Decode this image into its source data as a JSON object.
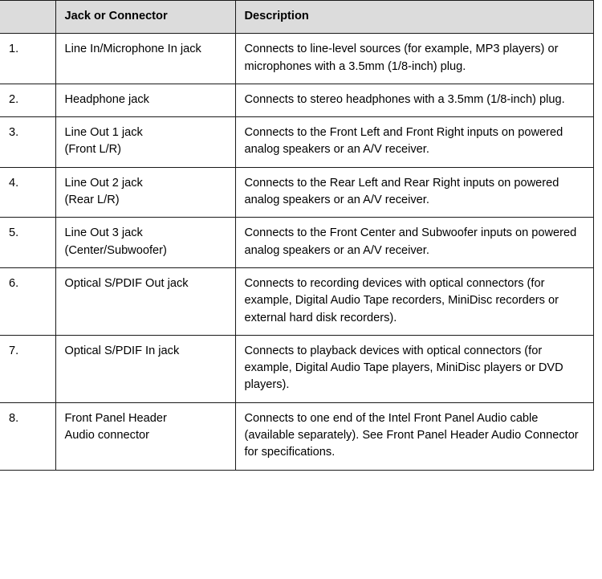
{
  "table": {
    "headers": {
      "number": "",
      "jack": "Jack or Connector",
      "description": "Description"
    },
    "rows": [
      {
        "number": "1.",
        "jack": "Line In/Microphone In jack",
        "description": "Connects to line-level sources (for example, MP3 players) or microphones with a 3.5mm (1/8-inch) plug."
      },
      {
        "number": "2.",
        "jack": "Headphone jack",
        "description": "Connects to stereo headphones with a 3.5mm (1/8-inch) plug."
      },
      {
        "number": "3.",
        "jack": "Line Out 1 jack (Front L/R)",
        "jack_line1": "Line Out 1 jack",
        "jack_line2": "(Front L/R)",
        "description": "Connects to the Front Left and Front Right inputs on powered analog speakers or an A/V receiver."
      },
      {
        "number": "4.",
        "jack": "Line Out 2 jack (Rear L/R)",
        "jack_line1": "Line Out 2 jack",
        "jack_line2": "(Rear L/R)",
        "description": "Connects to the Rear Left and Rear Right inputs on powered analog speakers or an A/V receiver."
      },
      {
        "number": "5.",
        "jack": "Line Out 3 jack (Center/Subwoofer)",
        "jack_line1": "Line Out 3 jack",
        "jack_line2": "(Center/Subwoofer)",
        "description": "Connects to the Front Center and Subwoofer inputs on powered analog speakers or an A/V receiver."
      },
      {
        "number": "6.",
        "jack": "Optical S/PDIF Out jack",
        "description": "Connects to recording devices with optical connectors (for example, Digital Audio Tape recorders, MiniDisc recorders or external hard disk recorders)."
      },
      {
        "number": "7.",
        "jack": "Optical S/PDIF In jack",
        "description": "Connects to playback devices with optical connectors (for example, Digital Audio Tape players, MiniDisc players or DVD players)."
      },
      {
        "number": "8.",
        "jack": "Front Panel Header Audio connector",
        "jack_line1": "Front Panel Header",
        "jack_line2": "Audio connector",
        "description": "Connects to one end of the Intel Front Panel Audio cable (available separately). See Front Panel Header Audio Connector for specifications."
      }
    ]
  },
  "colors": {
    "header_background": "#dcdcdc",
    "border": "#1a1a1a",
    "text": "#000000",
    "page_background": "#ffffff"
  }
}
